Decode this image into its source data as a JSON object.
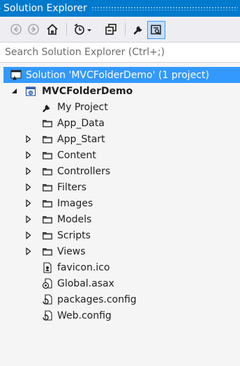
{
  "window": {
    "title": "Solution Explorer"
  },
  "search": {
    "placeholder": "Search Solution Explorer (Ctrl+;)"
  },
  "toolbar": {
    "items": [
      "back-icon",
      "forward-icon",
      "home-icon",
      "history-icon",
      "collapse-all-icon",
      "properties-icon",
      "preview-icon"
    ]
  },
  "tree": {
    "solution": {
      "label": "Solution 'MVCFolderDemo' (1 project)",
      "icon": "solution-icon"
    },
    "project": {
      "label": "MVCFolderDemo",
      "expanded": true,
      "icon": "project-icon"
    },
    "items": [
      {
        "label": "My Project",
        "icon": "wrench-icon",
        "expandable": false
      },
      {
        "label": "App_Data",
        "icon": "folder-icon",
        "expandable": false
      },
      {
        "label": "App_Start",
        "icon": "folder-icon",
        "expandable": true
      },
      {
        "label": "Content",
        "icon": "folder-icon",
        "expandable": true
      },
      {
        "label": "Controllers",
        "icon": "folder-icon",
        "expandable": true
      },
      {
        "label": "Filters",
        "icon": "folder-icon",
        "expandable": true
      },
      {
        "label": "Images",
        "icon": "folder-icon",
        "expandable": true
      },
      {
        "label": "Models",
        "icon": "folder-icon",
        "expandable": true
      },
      {
        "label": "Scripts",
        "icon": "folder-icon",
        "expandable": true
      },
      {
        "label": "Views",
        "icon": "folder-icon",
        "expandable": true
      },
      {
        "label": "favicon.ico",
        "icon": "image-file-icon",
        "expandable": false
      },
      {
        "label": "Global.asax",
        "icon": "global-asax-icon",
        "expandable": false
      },
      {
        "label": "packages.config",
        "icon": "config-file-icon",
        "expandable": false
      },
      {
        "label": "Web.config",
        "icon": "config-file-icon",
        "expandable": false
      }
    ]
  },
  "colors": {
    "accent": "#007acc",
    "selection": "#3399ff",
    "folder": "#424242"
  }
}
